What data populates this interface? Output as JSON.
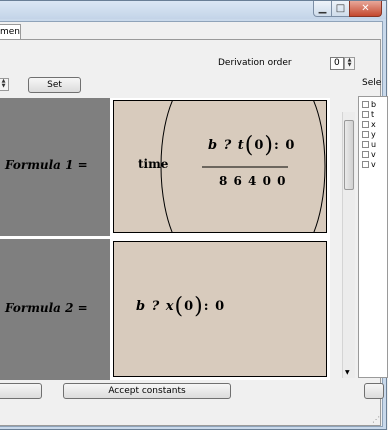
{
  "window": {
    "minimize_glyph": "▁",
    "maximize_glyph": "□",
    "close_glyph": "✕"
  },
  "tab": {
    "label": "ments"
  },
  "derivation": {
    "label": "Derivation order",
    "value": "0"
  },
  "set_button": {
    "label": "Set"
  },
  "selection": {
    "label": "Sele",
    "items": [
      "b",
      "t",
      "x",
      "y",
      "u",
      "v",
      "v"
    ]
  },
  "formulas": [
    {
      "label": "Formula 1 =",
      "prefix": "time",
      "numerator_pre": "b ? t",
      "argument": "0",
      "numerator_post": ": 0",
      "denominator": "8 6 4 0 0"
    },
    {
      "label": "Formula 2 =",
      "expression_pre": "b ? x",
      "argument": "0",
      "expression_post": ": 0"
    }
  ],
  "accept_button": {
    "label": "Accept constants"
  }
}
